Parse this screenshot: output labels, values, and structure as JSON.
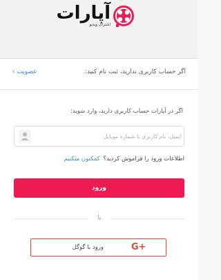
{
  "brand": {
    "name": "آپارات",
    "tagline": "اشتراک ویدیو",
    "accent_color": "#ed1b52",
    "link_color": "#3a8ad6"
  },
  "register": {
    "prompt": "اگر حساب کاربری ندارید، ثبت نام کنید:",
    "link": "عضویت ›"
  },
  "login": {
    "prompt": "اگر در آپارات حساب کاربری دارید، وارد شوید:",
    "input_placeholder": "ایمیل، نام کاربری یا شماره موبایل",
    "input_value": "",
    "forgot_text": "اطلاعات ورود را فراموش کردید؟",
    "forgot_link": "کمکتون میکنیم",
    "submit_label": "ورود"
  },
  "divider": {
    "label": "یا"
  },
  "google": {
    "label": "ورود با گوگل",
    "icon_text": "G+",
    "icon": "google-plus-icon"
  }
}
